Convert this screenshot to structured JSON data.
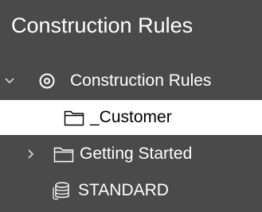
{
  "panel": {
    "title": "Construction Rules"
  },
  "tree": {
    "root": {
      "label": "Construction Rules",
      "expanded": true,
      "icon": "target-icon"
    },
    "items": [
      {
        "label": "_Customer",
        "icon": "folder-icon",
        "selected": true,
        "expandable": false
      },
      {
        "label": "Getting Started",
        "icon": "folder-icon",
        "selected": false,
        "expandable": true,
        "expanded": false
      },
      {
        "label": "STANDARD",
        "icon": "database-icon",
        "selected": false,
        "expandable": false
      }
    ]
  },
  "colors": {
    "background": "#4a4a4a",
    "text": "#ffffff",
    "selection": "#ffffff",
    "selected_text": "#000000"
  }
}
